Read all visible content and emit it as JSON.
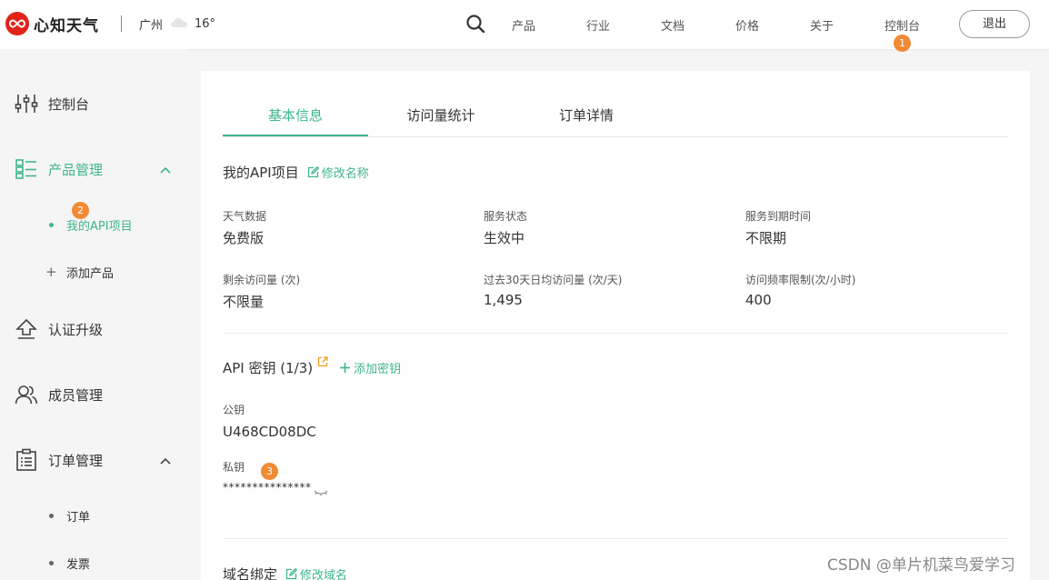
{
  "header": {
    "logo_text": "心知天气",
    "city": "广州",
    "temperature": "16°",
    "nav": [
      "产品",
      "行业",
      "文档",
      "价格",
      "关于",
      "控制台"
    ],
    "console_badge": "1",
    "logout_label": "退出"
  },
  "sidebar": {
    "console": "控制台",
    "product_mgmt": "产品管理",
    "product_badge": "2",
    "my_api": "我的API项目",
    "add_product": "添加产品",
    "auth_upgrade": "认证升级",
    "member_mgmt": "成员管理",
    "order_mgmt": "订单管理",
    "orders": "订单",
    "invoices": "发票"
  },
  "tabs": [
    "基本信息",
    "访问量统计",
    "订单详情"
  ],
  "project": {
    "title": "我的API项目",
    "rename_link": "修改名称",
    "fields": [
      {
        "label": "天气数据",
        "value": "免费版"
      },
      {
        "label": "服务状态",
        "value": "生效中"
      },
      {
        "label": "服务到期时间",
        "value": "不限期"
      },
      {
        "label": "剩余访问量 (次)",
        "value": "不限量"
      },
      {
        "label": "过去30天日均访问量 (次/天)",
        "value": "1,495"
      },
      {
        "label": "访问频率限制(次/小时)",
        "value": "400"
      }
    ]
  },
  "api_key": {
    "title": "API 密钥 (1/3)",
    "add_link": "添加密钥",
    "public_label": "公钥",
    "public_value": "U468CD08DC",
    "private_label": "私钥",
    "private_badge": "3",
    "private_value": "***************"
  },
  "domain": {
    "title": "域名绑定",
    "edit_link": "修改域名"
  },
  "watermark": "CSDN @单片机菜鸟爱学习",
  "colors": {
    "accent": "#3fb58f",
    "badge": "#f08a34",
    "brand": "#e2231a"
  }
}
